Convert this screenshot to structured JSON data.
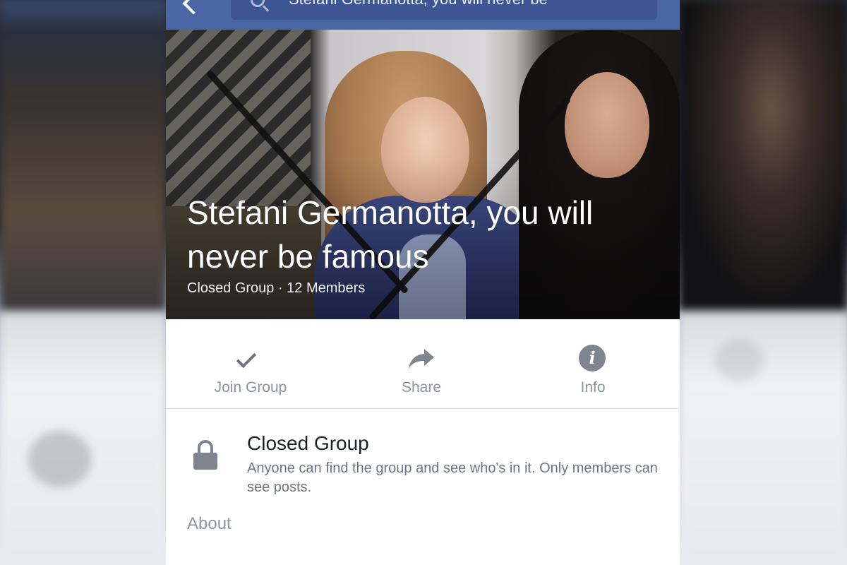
{
  "search": {
    "query": "Stefani Germanotta, you will never be"
  },
  "group": {
    "title": "Stefani Germanotta, you will never be famous",
    "meta": "Closed Group · 12 Members"
  },
  "actions": [
    {
      "label": "Join Group",
      "icon": "check-icon"
    },
    {
      "label": "Share",
      "icon": "share-icon"
    },
    {
      "label": "Info",
      "icon": "info-icon"
    }
  ],
  "privacy": {
    "title": "Closed Group",
    "description": "Anyone can find the group and see who's in it. Only members can see posts.",
    "icon": "lock-icon"
  },
  "about": {
    "label": "About"
  },
  "colors": {
    "header": "#4b66a4",
    "icon_gray": "#7f858f",
    "text_muted": "#8d949e"
  }
}
